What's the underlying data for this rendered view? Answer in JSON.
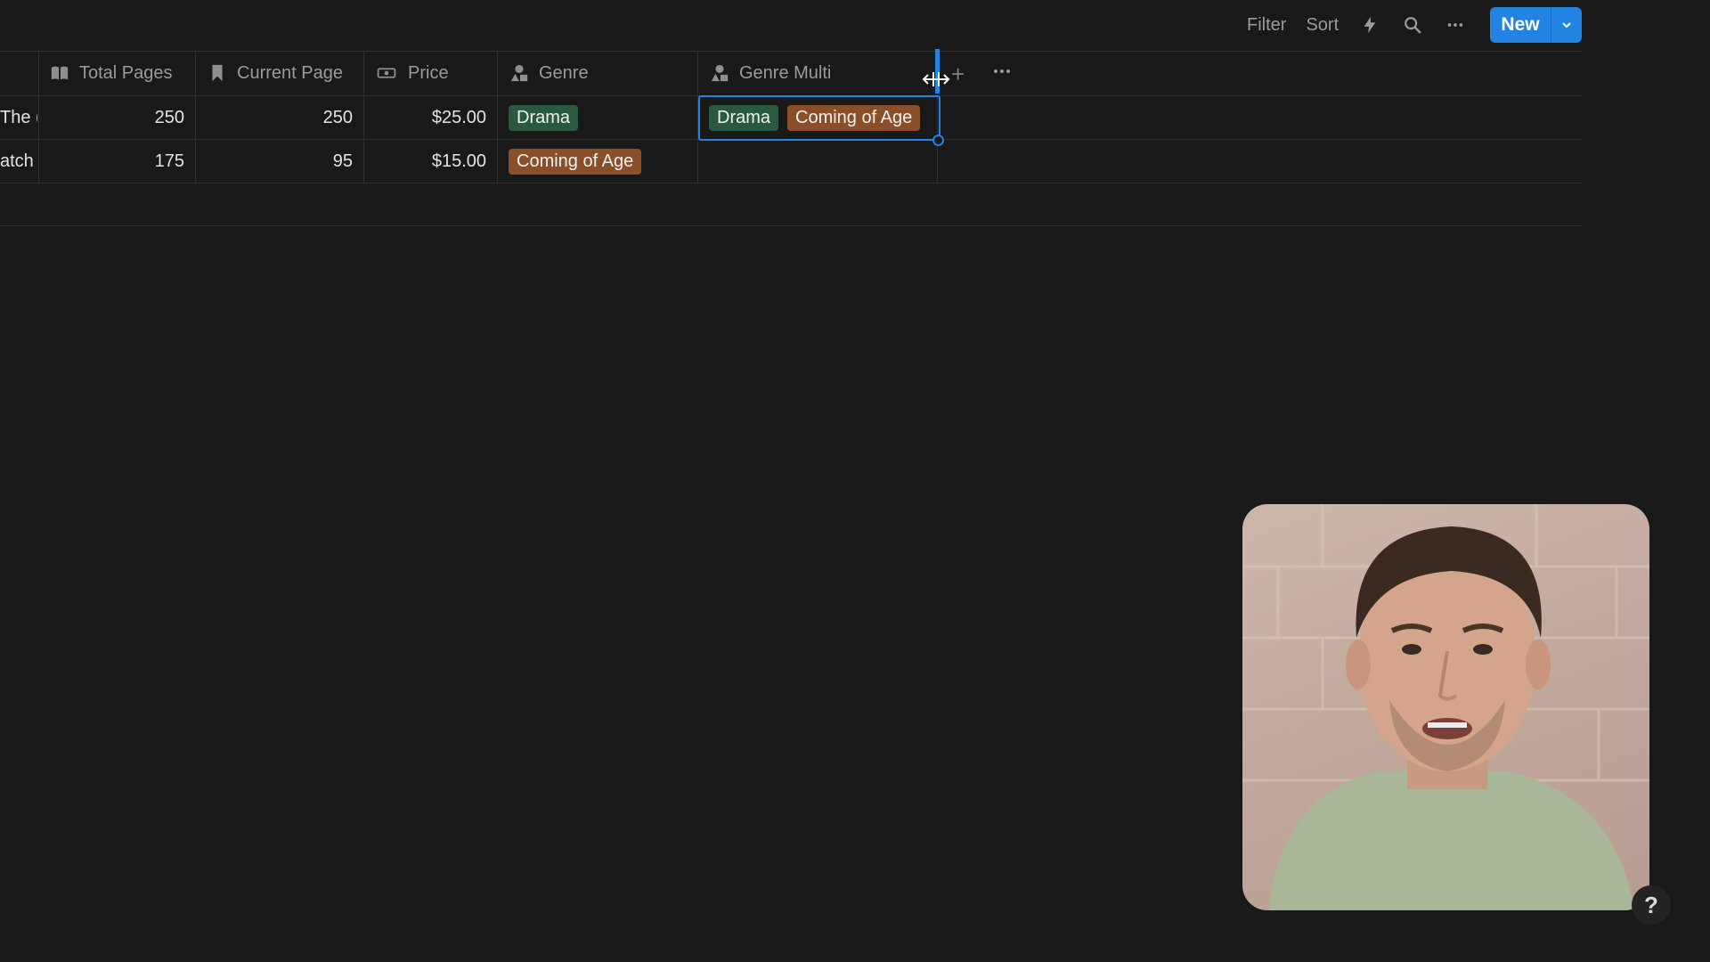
{
  "toolbar": {
    "filter_label": "Filter",
    "sort_label": "Sort",
    "new_label": "New"
  },
  "table": {
    "columns": [
      {
        "label": "Total Pages",
        "icon": "book-open-icon"
      },
      {
        "label": "Current Page",
        "icon": "bookmark-icon"
      },
      {
        "label": "Price",
        "icon": "ticket-icon"
      },
      {
        "label": "Genre",
        "icon": "shapes-icon"
      },
      {
        "label": "Genre Multi",
        "icon": "shapes-icon"
      }
    ],
    "rows": [
      {
        "title": "The (",
        "total_pages": "250",
        "current_page": "250",
        "price": "$25.00",
        "genre": "Drama",
        "genre_multi": [
          "Drama",
          "Coming of Age"
        ]
      },
      {
        "title": "atch",
        "total_pages": "175",
        "current_page": "95",
        "price": "$15.00",
        "genre": "Coming of Age",
        "genre_multi": []
      }
    ]
  },
  "colors": {
    "background": "#191919",
    "accent_blue": "#2383e2",
    "tag_green": "#2b5940",
    "tag_orange": "#8a4f28"
  },
  "help_label": "?"
}
